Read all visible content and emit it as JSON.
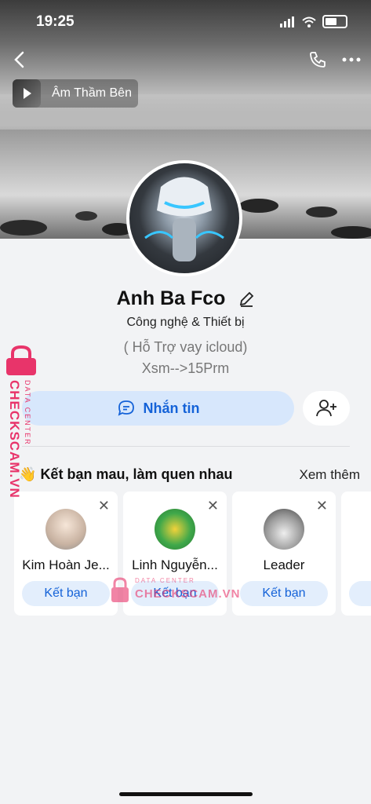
{
  "status": {
    "time": "19:25"
  },
  "music": {
    "title": "Âm Thầm Bên"
  },
  "profile": {
    "name": "Anh Ba Fco",
    "category": "Công nghệ & Thiết bị",
    "bio_line1": "( Hỗ Trợ vay icloud)",
    "bio_line2": "Xsm-->15Prm"
  },
  "actions": {
    "message_label": "Nhắn tin"
  },
  "suggestions": {
    "title": "Kết bạn mau, làm quen nhau",
    "more": "Xem thêm",
    "add_label": "Kết bạn",
    "items": [
      {
        "name": "Kim Hoàn Je..."
      },
      {
        "name": "Linh Nguyễn..."
      },
      {
        "name": "Leader"
      }
    ]
  },
  "watermark": {
    "brand": "CHECKSCAM.VN",
    "tag": "DATA CENTER"
  },
  "colors": {
    "accent": "#1462d8",
    "accent_bg": "#d7e7fc",
    "watermark": "#e8346a"
  }
}
